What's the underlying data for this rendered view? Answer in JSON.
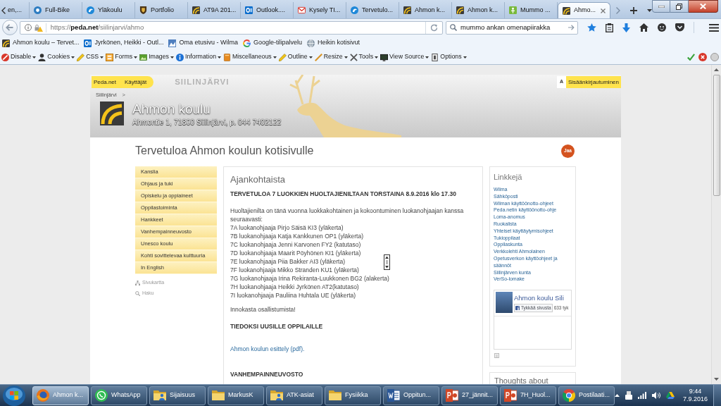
{
  "browser": {
    "tabs": [
      {
        "label": "en,...",
        "selected": false
      },
      {
        "label": "Full-Bike",
        "kind": "ring",
        "selected": false
      },
      {
        "label": "Yläkoulu",
        "kind": "swirl",
        "selected": false
      },
      {
        "label": "Portfolio",
        "kind": "crest",
        "selected": false
      },
      {
        "label": "AT9A 201...",
        "kind": "peda",
        "selected": false
      },
      {
        "label": "Outlook....",
        "kind": "outlook",
        "selected": false
      },
      {
        "label": "Kysely TI...",
        "kind": "mail",
        "selected": false
      },
      {
        "label": "Tervetulo...",
        "kind": "swirl",
        "selected": false
      },
      {
        "label": "Ahmon k...",
        "kind": "peda",
        "selected": false
      },
      {
        "label": "Ahmon k...",
        "kind": "peda",
        "selected": false
      },
      {
        "label": "Mummo ...",
        "kind": "green",
        "selected": false
      },
      {
        "label": "Ahmo...",
        "kind": "peda",
        "selected": true
      }
    ],
    "address": {
      "scheme": "https://",
      "host": "peda.net",
      "path": "/siilinjarvi/ahmo"
    },
    "search": {
      "value": "mummo ankan omenapiirakka"
    },
    "bookmarks": [
      {
        "label": "Ahmon koulu – Tervet...",
        "kind": "peda"
      },
      {
        "label": "Jyrkönen, Heikki - Outl...",
        "kind": "outlook"
      },
      {
        "label": "Oma etusivu - Wilma",
        "kind": "wilma"
      },
      {
        "label": "Google-tilipalvelu",
        "kind": "google"
      },
      {
        "label": "Heikin kotisivut",
        "kind": "globe"
      }
    ],
    "developer_toolbar": [
      {
        "kind": "disable",
        "label": "Disable"
      },
      {
        "kind": "cookies",
        "label": "Cookies"
      },
      {
        "kind": "css",
        "label": "CSS"
      },
      {
        "kind": "forms",
        "label": "Forms"
      },
      {
        "kind": "images",
        "label": "Images"
      },
      {
        "kind": "information",
        "label": "Information"
      },
      {
        "kind": "miscellaneous",
        "label": "Miscellaneous"
      },
      {
        "kind": "outline",
        "label": "Outline"
      },
      {
        "kind": "resize",
        "label": "Resize"
      },
      {
        "kind": "tools",
        "label": "Tools"
      },
      {
        "kind": "viewsource",
        "label": "View Source"
      },
      {
        "kind": "options",
        "label": "Options"
      }
    ]
  },
  "page": {
    "header": {
      "links": [
        "Peda.net",
        "Käyttäjät"
      ],
      "area": "SIILINJÄRVI",
      "font_button": "A",
      "login": "Sisäänkirjautuminen",
      "breadcrumb": "Siilinjärvi",
      "breadcrumb_separator": ">",
      "school_name": "Ahmon koulu",
      "address": "Ahmontie 1, 71800 Siilinjärvi, p. 044 7402122"
    },
    "title": "Tervetuloa Ahmon koulun kotisivulle",
    "share": "Jaa",
    "menu": [
      "Kanslia",
      "Ohjaus ja tuki",
      "Opiskelu ja oppiaineet",
      "Oppilastoiminta",
      "Hankkeet",
      "Vanhempainneuvosto",
      "Unesco koulu",
      "Kohti sovittelevaa kulttuuria",
      "In English"
    ],
    "tools": [
      {
        "kind": "sitemap",
        "label": "Sivukartta"
      },
      {
        "kind": "search",
        "label": "Haku"
      }
    ],
    "news": {
      "title": "Ajankohtaista",
      "blocks": [
        {
          "kind": "heading",
          "text": "TERVETULOA 7 LUOKKIEN HUOLTAJIENILTAAN TORSTAINA 8.9.2016 klo 17.30"
        },
        {
          "kind": "lines",
          "lines": [
            "Huoltajienilta on tänä vuonna luokkakohtainen ja kokoontuminen luokanohjaajan kanssa seuraavasti:",
            "7A luokanohjaaja Pirjo Säisä KI3 (yläkerta)",
            "7B luokanohjaaja Katja Kankkunen OP1 (yläkerta)",
            "7C luokanohjaaja Jenni Karvonen FY2 (katutaso)",
            "7D luokanohjaaja Maarit Pöyhönen KI1 (yläkerta)",
            "7E luokanohjaaja Piia Bakker AI3 (yläkerta)",
            "7F luokanohjaaja Mikko Stranden KU1 (yläkerta)",
            "7G luokanohjaaja Irina Rekiranta-Luukkonen BG2 (alakerta)",
            "7H luokanohjaaja Heikki Jyrkönen AT2(katutaso)",
            "7I luokanohjaaja Pauliina Huhtala UE (yläkerta)"
          ]
        },
        {
          "kind": "text",
          "text": "Innokasta osallistumista!"
        },
        {
          "kind": "heading",
          "text": "TIEDOKSI UUSILLE OPPILAILLE"
        },
        {
          "kind": "link",
          "text": "Ahmon koulun esittely (pdf)."
        },
        {
          "kind": "heading",
          "text": "VANHEMPAINNEUVOSTO"
        }
      ]
    },
    "links": {
      "title": "Linkkejä",
      "items": [
        "Wilma",
        "Sähköposti",
        "Wilman käyttöönotto-ohjeet",
        "Peda.netin käyttöönotto-ohje",
        "Loma-anomus",
        "Ruokalista",
        "Yhteiset käyttäytymisohjeet",
        "Tukioppilaat",
        "Oppilaskunta",
        "Verkkolehti Ahmolainen",
        "Opetusverkon käyttöohjeet ja säännöt",
        "Siilinjärven kunta",
        "VerSo-lomake"
      ]
    },
    "facebook": {
      "name": "Ahmon koulu Sili",
      "like": "Tykkää sivusta",
      "count": "633 tyk"
    },
    "next_box": {
      "title": "Thoughts about"
    }
  },
  "taskbar": {
    "items": [
      {
        "kind": "firefox",
        "label": "Ahmon k...",
        "selected": true
      },
      {
        "kind": "whatsapp",
        "label": "WhatsApp",
        "selected": false
      },
      {
        "kind": "userfolder",
        "label": "Sijaisuus",
        "selected": false
      },
      {
        "kind": "folder",
        "label": "MarkusK",
        "selected": false
      },
      {
        "kind": "userfolder",
        "label": "ATK-asiat",
        "selected": false
      },
      {
        "kind": "folder",
        "label": "Fysiikka",
        "selected": false
      },
      {
        "kind": "word",
        "label": "Oppitun...",
        "selected": false
      },
      {
        "kind": "powerpoint",
        "label": "27_jännit...",
        "selected": false
      },
      {
        "kind": "powerpoint",
        "label": "7H_Huol...",
        "selected": false
      },
      {
        "kind": "chrome",
        "label": "Postilaati...",
        "selected": false
      }
    ],
    "time": "9:44",
    "date": "7.9.2016"
  }
}
